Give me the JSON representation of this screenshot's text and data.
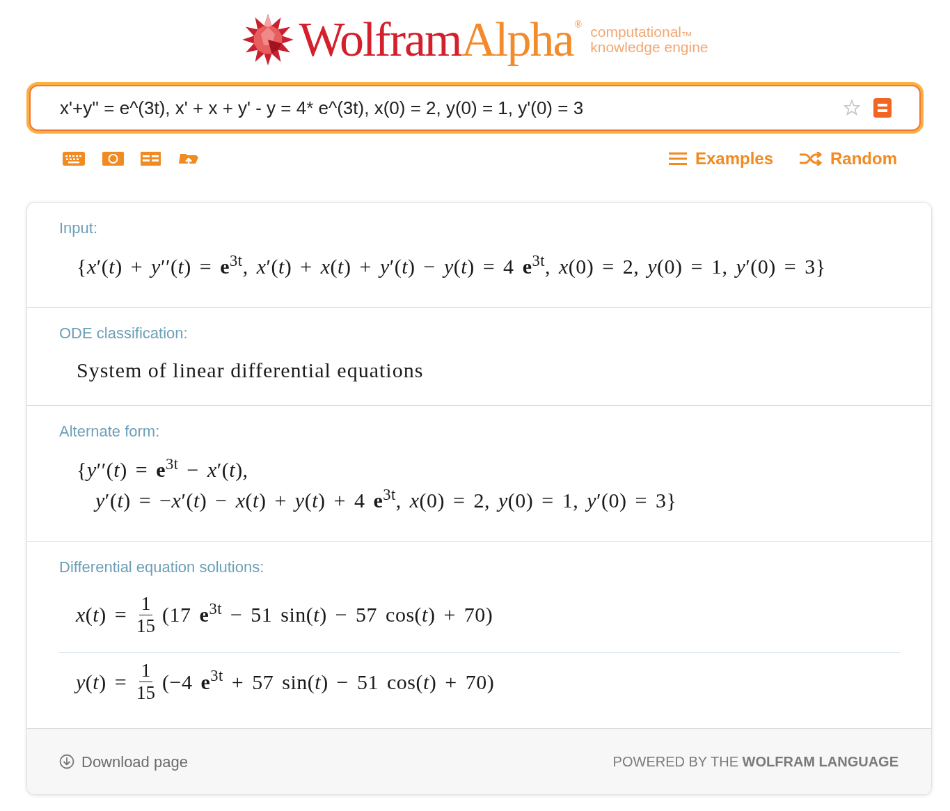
{
  "header": {
    "logo": {
      "wordmark_1": "Wolfram",
      "wordmark_2": "Alpha",
      "registered": "®",
      "tagline_1": "computational$_{™}$",
      "tagline_2": "knowledge engine"
    }
  },
  "search": {
    "value": "x'+y'' = e^(3t), x' + x + y' - y = 4* e^(3t), x(0) = 2, y(0) = 1, y'(0) = 3"
  },
  "toolbar": {
    "links": [
      {
        "kind": "examples",
        "label": "Examples"
      },
      {
        "kind": "random",
        "label": "Random"
      }
    ]
  },
  "pods": [
    {
      "title": "Input:",
      "kind": "math",
      "lines": [
        "{*x*′(*t*) + *y*′′(*t*) = **e**$^{3t}$, *x*′(*t*) + *x*(*t*) + *y*′(*t*) − *y*(*t*) = 4 **e**$^{3t}$, *x*(0) = 2, *y*(0) = 1, *y*′(0) = 3}"
      ]
    },
    {
      "title": "ODE classification:",
      "kind": "text",
      "text": "System of linear differential equations"
    },
    {
      "title": "Alternate form:",
      "kind": "math",
      "lines": [
        "{*y*′′(*t*) = **e**$^{3t}$ − *x*′(*t*),",
        "*y*′(*t*) = −*x*′(*t*) − *x*(*t*) + *y*(*t*) + 4 **e**$^{3t}$, *x*(0) = 2, *y*(0) = 1, *y*′(0) = 3}"
      ]
    },
    {
      "title": "Differential equation solutions:",
      "kind": "solutions",
      "items": [
        {
          "lhs": "*x*(*t*) =",
          "numerator": "1",
          "denominator": "15",
          "rhs": "(17 **e**$^{3t}$ − 51 sin(*t*) − 57 cos(*t*) + 70)"
        },
        {
          "lhs": "*y*(*t*) =",
          "numerator": "1",
          "denominator": "15",
          "rhs": "(−4 **e**$^{3t}$ + 57 sin(*t*) − 51 cos(*t*) + 70)"
        }
      ]
    }
  ],
  "footer": {
    "download": "Download page",
    "powered": "POWERED BY THE **WOLFRAM LANGUAGE**"
  }
}
